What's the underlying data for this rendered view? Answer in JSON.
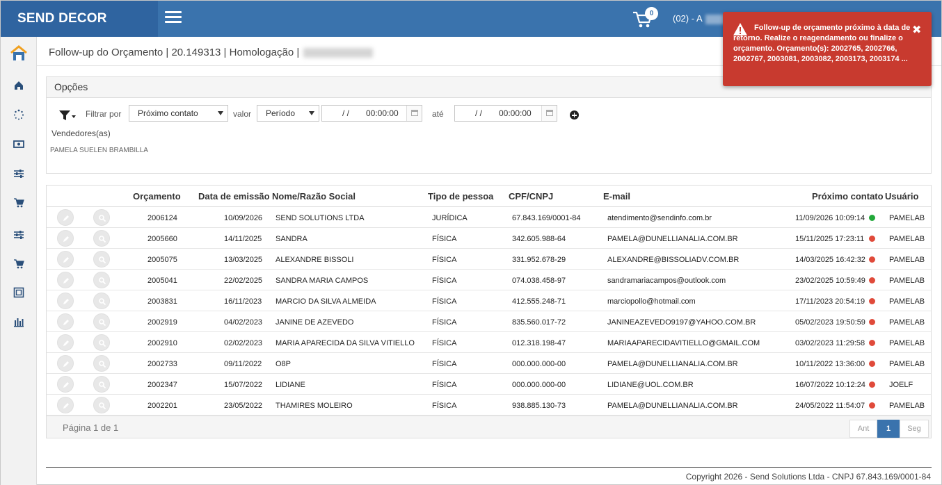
{
  "app": {
    "brand": "SEND DECOR"
  },
  "topbar": {
    "cart_count": "0",
    "user_prefix": "(02) - A"
  },
  "page": {
    "title": "Follow-up do Orçamento | 20.149313 | Homologação |"
  },
  "options": {
    "heading": "Opções",
    "filter_label": "Filtrar por",
    "filter_value": "Próximo contato",
    "valor_label": "valor",
    "period_value": "Período",
    "date_from": "/ /",
    "time_from": "00:00:00",
    "ate_label": "até",
    "date_to": "/ /",
    "time_to": "00:00:00",
    "sellers_label": "Vendedores(as)",
    "seller_name": "PAMELA SUELEN BRAMBILLA"
  },
  "table": {
    "headers": {
      "orcamento": "Orçamento",
      "data": "Data de emissão",
      "nome": "Nome/Razão Social",
      "tipo": "Tipo de pessoa",
      "cpf": "CPF/CNPJ",
      "email": "E-mail",
      "proximo": "Próximo contato",
      "usuario": "Usuário"
    },
    "rows": [
      {
        "orc": "2006124",
        "data": "10/09/2026",
        "nome": "SEND SOLUTIONS LTDA",
        "tipo": "JURÍDICA",
        "cpf": "67.843.169/0001-84",
        "email": "atendimento@sendinfo.com.br",
        "proximo": "11/09/2026 10:09:14",
        "status": "green",
        "usuario": "PAMELAB"
      },
      {
        "orc": "2005660",
        "data": "14/11/2025",
        "nome": "SANDRA",
        "tipo": "FÍSICA",
        "cpf": "342.605.988-64",
        "email": "PAMELA@DUNELLIANALIA.COM.BR",
        "proximo": "15/11/2025 17:23:11",
        "status": "red",
        "usuario": "PAMELAB"
      },
      {
        "orc": "2005075",
        "data": "13/03/2025",
        "nome": "ALEXANDRE BISSOLI",
        "tipo": "FÍSICA",
        "cpf": "331.952.678-29",
        "email": "ALEXANDRE@BISSOLIADV.COM.BR",
        "proximo": "14/03/2025 16:42:32",
        "status": "red",
        "usuario": "PAMELAB"
      },
      {
        "orc": "2005041",
        "data": "22/02/2025",
        "nome": "SANDRA MARIA CAMPOS",
        "tipo": "FÍSICA",
        "cpf": "074.038.458-97",
        "email": "sandramariacampos@outlook.com",
        "proximo": "23/02/2025 10:59:49",
        "status": "red",
        "usuario": "PAMELAB"
      },
      {
        "orc": "2003831",
        "data": "16/11/2023",
        "nome": "MARCIO DA SILVA ALMEIDA",
        "tipo": "FÍSICA",
        "cpf": "412.555.248-71",
        "email": "marciopollo@hotmail.com",
        "proximo": "17/11/2023 20:54:19",
        "status": "red",
        "usuario": "PAMELAB"
      },
      {
        "orc": "2002919",
        "data": "04/02/2023",
        "nome": "JANINE DE AZEVEDO",
        "tipo": "FÍSICA",
        "cpf": "835.560.017-72",
        "email": "JANINEAZEVEDO9197@YAHOO.COM.BR",
        "proximo": "05/02/2023 19:50:59",
        "status": "red",
        "usuario": "PAMELAB"
      },
      {
        "orc": "2002910",
        "data": "02/02/2023",
        "nome": "MARIA APARECIDA DA SILVA VITIELLO",
        "tipo": "FÍSICA",
        "cpf": "012.318.198-47",
        "email": "MARIAAPARECIDAVITIELLO@GMAIL.COM",
        "proximo": "03/02/2023 11:29:58",
        "status": "red",
        "usuario": "PAMELAB"
      },
      {
        "orc": "2002733",
        "data": "09/11/2022",
        "nome": "O8P",
        "tipo": "FÍSICA",
        "cpf": "000.000.000-00",
        "email": "PAMELA@DUNELLIANALIA.COM.BR",
        "proximo": "10/11/2022 13:36:00",
        "status": "red",
        "usuario": "PAMELAB"
      },
      {
        "orc": "2002347",
        "data": "15/07/2022",
        "nome": "LIDIANE",
        "tipo": "FÍSICA",
        "cpf": "000.000.000-00",
        "email": "LIDIANE@UOL.COM.BR",
        "proximo": "16/07/2022 10:12:24",
        "status": "red",
        "usuario": "JOELF"
      },
      {
        "orc": "2002201",
        "data": "23/05/2022",
        "nome": "THAMIRES MOLEIRO",
        "tipo": "FÍSICA",
        "cpf": "938.885.130-73",
        "email": "PAMELA@DUNELLIANALIA.COM.BR",
        "proximo": "24/05/2022 11:54:07",
        "status": "red",
        "usuario": "PAMELAB"
      }
    ],
    "page_info": "Página 1 de 1",
    "pager": {
      "prev": "Ant",
      "current": "1",
      "next": "Seg"
    }
  },
  "colors": {
    "status_green": "#22a83a",
    "status_red": "#e04a3a",
    "brand_blue": "#3a73ad",
    "toast_red": "#c83a2f"
  },
  "notification": {
    "icon": "warning-icon",
    "message": "Follow-up de orçamento próximo à data de retorno. Realize o reagendamento ou finalize o orçamento. Orçamento(s): 2002765, 2002766, 2002767, 2003081, 2003082, 2003173, 2003174 ...",
    "close": "✖"
  },
  "footer": {
    "copyright": "Copyright 2026 - Send Solutions Ltda - CNPJ 67.843.169/0001-84"
  }
}
